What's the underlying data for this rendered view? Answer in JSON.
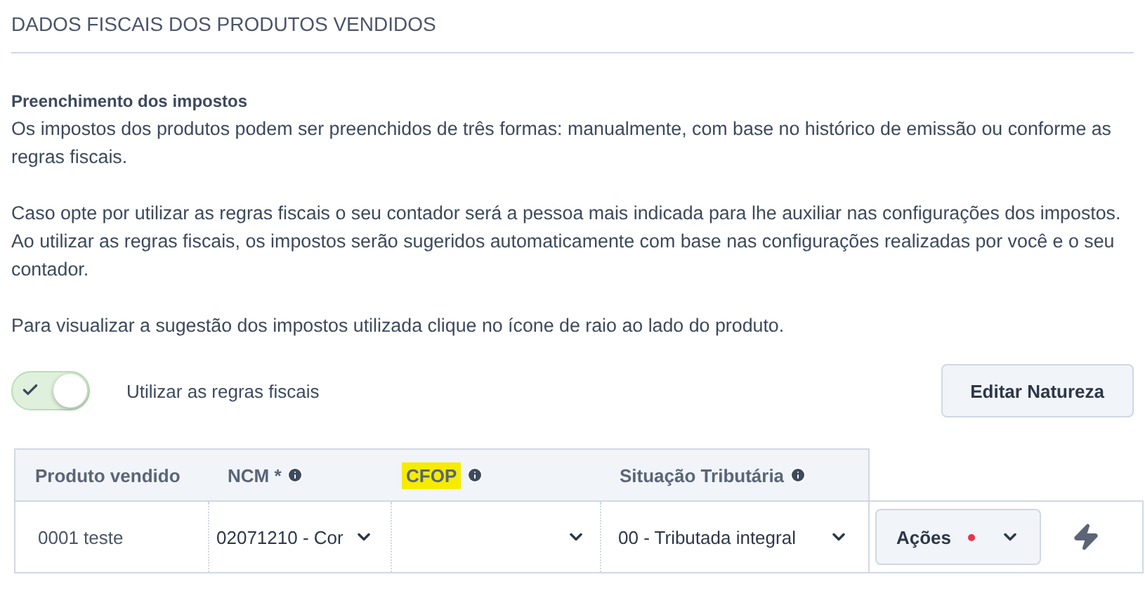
{
  "section_title": "DADOS FISCAIS DOS PRODUTOS VENDIDOS",
  "info": {
    "heading": "Preenchimento dos impostos",
    "paragraphs": [
      "Os impostos dos produtos podem ser preenchidos de três formas: manualmente, com base no histórico de emissão ou conforme as regras fiscais.",
      "Caso opte por utilizar as regras fiscais o seu contador será a pessoa mais indicada para lhe auxiliar nas configurações dos impostos. Ao utilizar as regras fiscais, os impostos serão sugeridos automaticamente com base nas configurações realizadas por você e o seu contador.",
      "Para visualizar a sugestão dos impostos utilizada clique no ícone de raio ao lado do produto."
    ]
  },
  "toggle": {
    "label": "Utilizar as regras fiscais",
    "on": true
  },
  "edit_button": "Editar Natureza",
  "table": {
    "columns": [
      {
        "label": "Produto vendido",
        "info": false,
        "highlighted": false
      },
      {
        "label": "NCM *",
        "info": true,
        "highlighted": false
      },
      {
        "label": "CFOP",
        "info": true,
        "highlighted": true
      },
      {
        "label": "Situação Tributária",
        "info": true,
        "highlighted": false
      }
    ],
    "rows": [
      {
        "product": "0001 teste",
        "ncm": "02071210 - Cor",
        "cfop": "",
        "situacao": "00 - Tributada integral",
        "actions": {
          "label": "Ações",
          "alert": true
        }
      }
    ]
  }
}
